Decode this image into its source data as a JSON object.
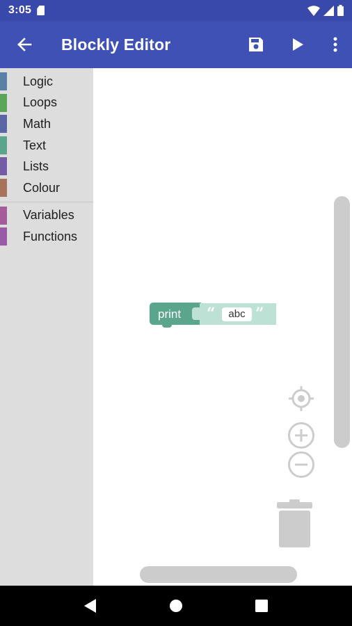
{
  "status_bar": {
    "time": "3:05"
  },
  "app_bar": {
    "title": "Blockly Editor",
    "icons": [
      "arrow-back-icon",
      "save-icon",
      "play-icon",
      "more-vert-icon"
    ]
  },
  "toolbox": {
    "categories": [
      {
        "label": "Logic",
        "color": "#5b80a5"
      },
      {
        "label": "Loops",
        "color": "#5ba55b"
      },
      {
        "label": "Math",
        "color": "#5b67a5"
      },
      {
        "label": "Text",
        "color": "#5ba58c"
      },
      {
        "label": "Lists",
        "color": "#745ba5"
      },
      {
        "label": "Colour",
        "color": "#a5745b"
      },
      {
        "label": "Variables",
        "color": "#a55b99"
      },
      {
        "label": "Functions",
        "color": "#995ba5"
      }
    ]
  },
  "workspace": {
    "print_block": {
      "label": "print",
      "color": "#5ba58c"
    },
    "text_block": {
      "value": "abc",
      "open_quote": "“",
      "close_quote": "”",
      "color": "#bde1d5"
    },
    "controls": [
      "recenter-icon",
      "zoom-in-icon",
      "zoom-out-icon",
      "trash-icon"
    ]
  },
  "nav_bar": {
    "icons": [
      "back-triangle-icon",
      "home-circle-icon",
      "recents-square-icon"
    ]
  }
}
